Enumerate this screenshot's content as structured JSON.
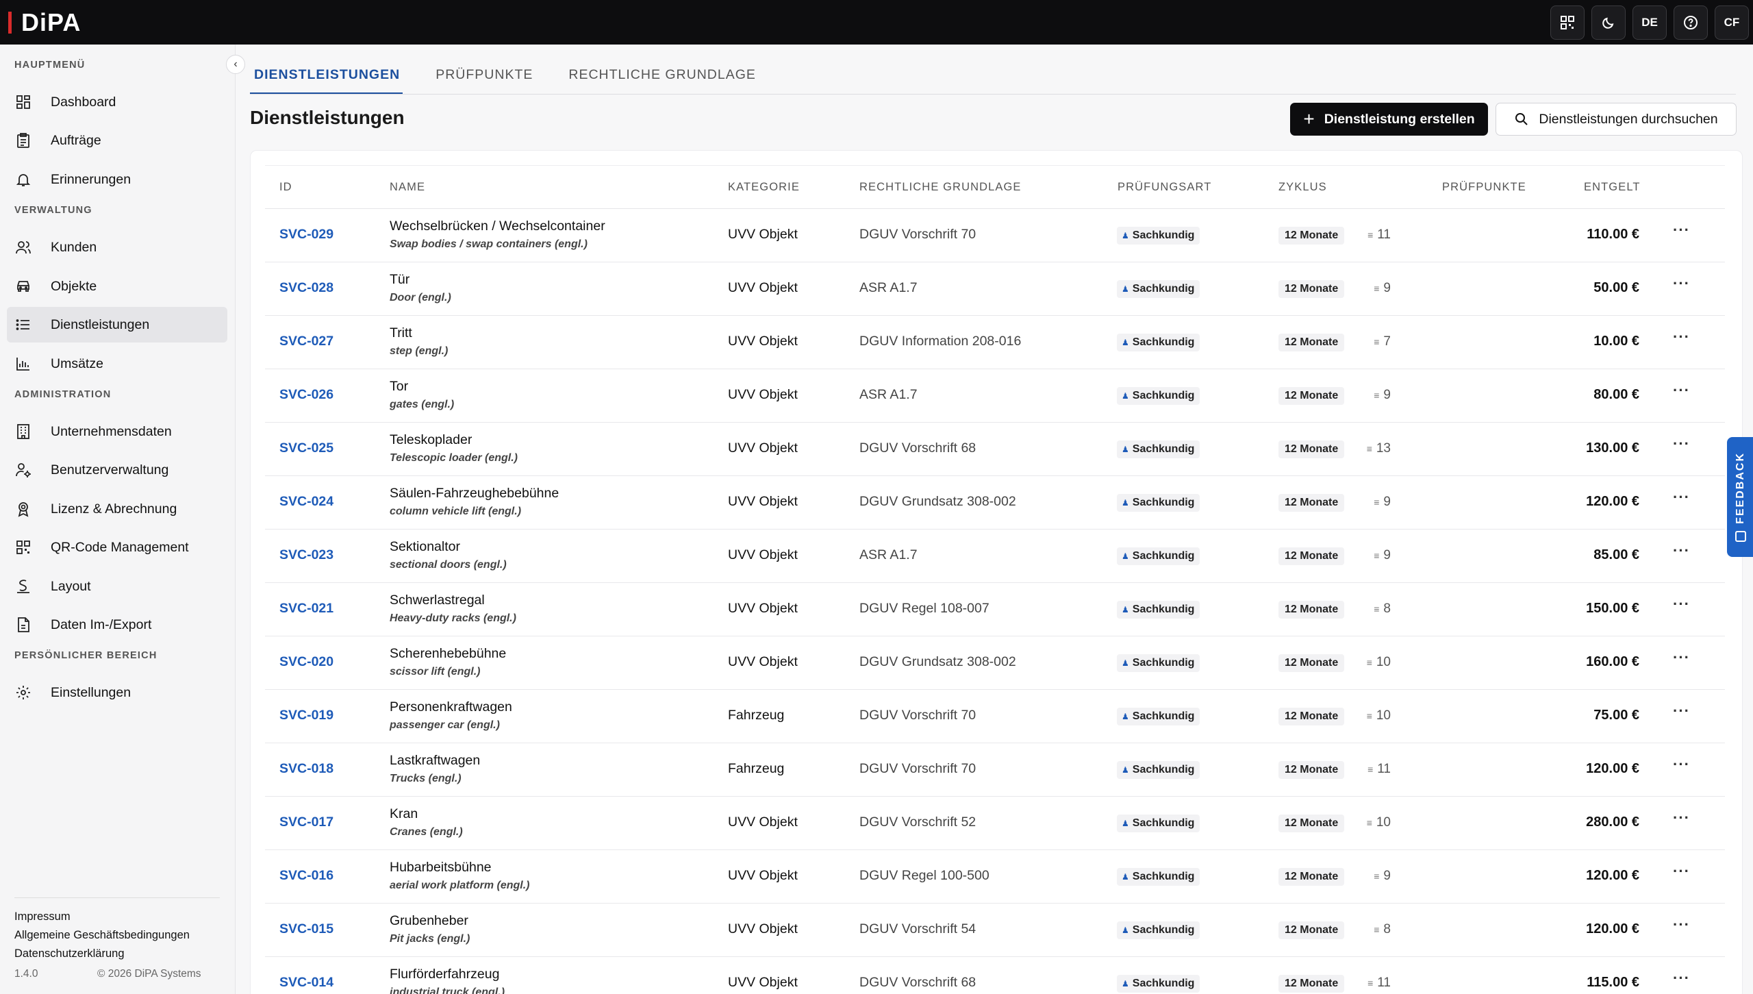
{
  "app": {
    "name": "DiPA"
  },
  "topbar": {
    "qr_label": "",
    "theme_label": "",
    "lang": "DE",
    "help_label": "",
    "avatar": "CF"
  },
  "sidebar": {
    "sections": [
      "HAUPTMENÜ",
      "VERWALTUNG",
      "ADMINISTRATION",
      "PERSÖNLICHER BEREICH"
    ],
    "items": [
      {
        "label": "Dashboard",
        "icon": "dashboard-icon"
      },
      {
        "label": "Aufträge",
        "icon": "clipboard-icon"
      },
      {
        "label": "Erinnerungen",
        "icon": "bell-icon"
      },
      {
        "label": "Kunden",
        "icon": "users-icon"
      },
      {
        "label": "Objekte",
        "icon": "car-icon"
      },
      {
        "label": "Dienstleistungen",
        "icon": "list-icon"
      },
      {
        "label": "Umsätze",
        "icon": "bar-chart-icon"
      },
      {
        "label": "Unternehmensdaten",
        "icon": "building-icon"
      },
      {
        "label": "Benutzerverwaltung",
        "icon": "user-gear-icon"
      },
      {
        "label": "Lizenz & Abrechnung",
        "icon": "license-icon"
      },
      {
        "label": "QR-Code Management",
        "icon": "qr-icon"
      },
      {
        "label": "Layout",
        "icon": "layout-icon"
      },
      {
        "label": "Daten Im-/Export",
        "icon": "file-export-icon"
      },
      {
        "label": "Einstellungen",
        "icon": "gear-icon"
      }
    ],
    "footer": {
      "links": [
        "Impressum",
        "Allgemeine Geschäftsbedingungen",
        "Datenschutzerklärung"
      ],
      "version": "1.4.0",
      "copyright": "© 2026 DiPA Systems"
    }
  },
  "tabs": [
    "DIENSTLEISTUNGEN",
    "PRÜFPUNKTE",
    "RECHTLICHE GRUNDLAGE"
  ],
  "page": {
    "title": "Dienstleistungen",
    "create_label": "Dienstleistung erstellen",
    "search_label": "Dienstleistungen durchsuchen"
  },
  "table": {
    "headers": [
      "ID",
      "NAME",
      "KATEGORIE",
      "RECHTLICHE GRUNDLAGE",
      "PRÜFUNGSART",
      "ZYKLUS",
      "PRÜFPUNKTE",
      "ENTGELT"
    ],
    "rows": [
      {
        "id": "SVC-029",
        "name": "Wechselbrücken / Wechselcontainer",
        "sub": "Swap bodies / swap containers (engl.)",
        "kategorie": "UVV Objekt",
        "grundlage": "DGUV Vorschrift 70",
        "art": "Sachkundig",
        "zyklus": "12 Monate",
        "pp": "11",
        "entgelt": "110.00 €"
      },
      {
        "id": "SVC-028",
        "name": "Tür",
        "sub": "Door (engl.)",
        "kategorie": "UVV Objekt",
        "grundlage": "ASR A1.7",
        "art": "Sachkundig",
        "zyklus": "12 Monate",
        "pp": "9",
        "entgelt": "50.00 €"
      },
      {
        "id": "SVC-027",
        "name": "Tritt",
        "sub": "step (engl.)",
        "kategorie": "UVV Objekt",
        "grundlage": "DGUV Information 208-016",
        "art": "Sachkundig",
        "zyklus": "12 Monate",
        "pp": "7",
        "entgelt": "10.00 €"
      },
      {
        "id": "SVC-026",
        "name": "Tor",
        "sub": "gates (engl.)",
        "kategorie": "UVV Objekt",
        "grundlage": "ASR A1.7",
        "art": "Sachkundig",
        "zyklus": "12 Monate",
        "pp": "9",
        "entgelt": "80.00 €"
      },
      {
        "id": "SVC-025",
        "name": "Teleskoplader",
        "sub": "Telescopic loader (engl.)",
        "kategorie": "UVV Objekt",
        "grundlage": "DGUV Vorschrift 68",
        "art": "Sachkundig",
        "zyklus": "12 Monate",
        "pp": "13",
        "entgelt": "130.00 €"
      },
      {
        "id": "SVC-024",
        "name": "Säulen-Fahrzeughebebühne",
        "sub": "column vehicle lift (engl.)",
        "kategorie": "UVV Objekt",
        "grundlage": "DGUV Grundsatz 308-002",
        "art": "Sachkundig",
        "zyklus": "12 Monate",
        "pp": "9",
        "entgelt": "120.00 €"
      },
      {
        "id": "SVC-023",
        "name": "Sektionaltor",
        "sub": "sectional doors (engl.)",
        "kategorie": "UVV Objekt",
        "grundlage": "ASR A1.7",
        "art": "Sachkundig",
        "zyklus": "12 Monate",
        "pp": "9",
        "entgelt": "85.00 €"
      },
      {
        "id": "SVC-021",
        "name": "Schwerlastregal",
        "sub": "Heavy-duty racks (engl.)",
        "kategorie": "UVV Objekt",
        "grundlage": "DGUV Regel 108-007",
        "art": "Sachkundig",
        "zyklus": "12 Monate",
        "pp": "8",
        "entgelt": "150.00 €"
      },
      {
        "id": "SVC-020",
        "name": "Scherenhebebühne",
        "sub": "scissor lift (engl.)",
        "kategorie": "UVV Objekt",
        "grundlage": "DGUV Grundsatz 308-002",
        "art": "Sachkundig",
        "zyklus": "12 Monate",
        "pp": "10",
        "entgelt": "160.00 €"
      },
      {
        "id": "SVC-019",
        "name": "Personenkraftwagen",
        "sub": "passenger car (engl.)",
        "kategorie": "Fahrzeug",
        "grundlage": "DGUV Vorschrift 70",
        "art": "Sachkundig",
        "zyklus": "12 Monate",
        "pp": "10",
        "entgelt": "75.00 €"
      },
      {
        "id": "SVC-018",
        "name": "Lastkraftwagen",
        "sub": "Trucks (engl.)",
        "kategorie": "Fahrzeug",
        "grundlage": "DGUV Vorschrift 70",
        "art": "Sachkundig",
        "zyklus": "12 Monate",
        "pp": "11",
        "entgelt": "120.00 €"
      },
      {
        "id": "SVC-017",
        "name": "Kran",
        "sub": "Cranes (engl.)",
        "kategorie": "UVV Objekt",
        "grundlage": "DGUV Vorschrift 52",
        "art": "Sachkundig",
        "zyklus": "12 Monate",
        "pp": "10",
        "entgelt": "280.00 €"
      },
      {
        "id": "SVC-016",
        "name": "Hubarbeitsbühne",
        "sub": "aerial work platform (engl.)",
        "kategorie": "UVV Objekt",
        "grundlage": "DGUV Regel 100-500",
        "art": "Sachkundig",
        "zyklus": "12 Monate",
        "pp": "9",
        "entgelt": "120.00 €"
      },
      {
        "id": "SVC-015",
        "name": "Grubenheber",
        "sub": "Pit jacks (engl.)",
        "kategorie": "UVV Objekt",
        "grundlage": "DGUV Vorschrift 54",
        "art": "Sachkundig",
        "zyklus": "12 Monate",
        "pp": "8",
        "entgelt": "120.00 €"
      },
      {
        "id": "SVC-014",
        "name": "Flurförderfahrzeug",
        "sub": "industrial truck (engl.)",
        "kategorie": "UVV Objekt",
        "grundlage": "DGUV Vorschrift 68",
        "art": "Sachkundig",
        "zyklus": "12 Monate",
        "pp": "11",
        "entgelt": "115.00 €"
      }
    ]
  },
  "feedback": {
    "label": "FEEDBACK"
  },
  "colors": {
    "accent": "#1e5bb8",
    "topbar": "#0d0d0f",
    "brand_red": "#d92b2b",
    "feedback": "#1f63c6"
  }
}
